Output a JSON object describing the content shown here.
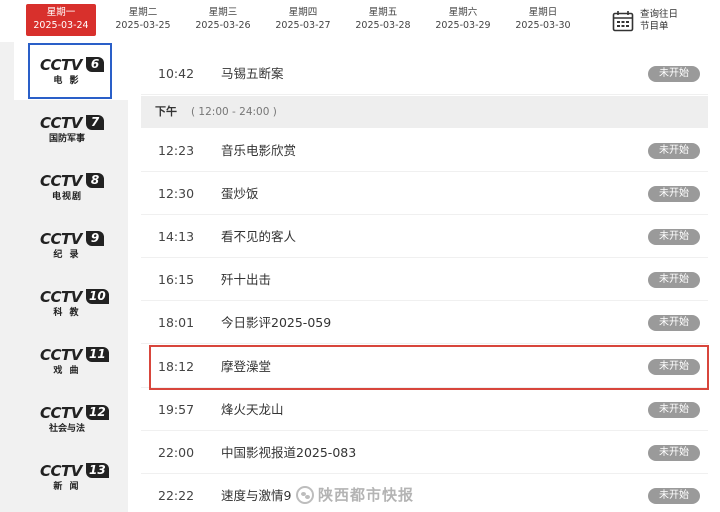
{
  "dates": [
    {
      "weekday": "星期一",
      "date": "2025-03-24",
      "active": true
    },
    {
      "weekday": "星期二",
      "date": "2025-03-25"
    },
    {
      "weekday": "星期三",
      "date": "2025-03-26"
    },
    {
      "weekday": "星期四",
      "date": "2025-03-27"
    },
    {
      "weekday": "星期五",
      "date": "2025-03-28"
    },
    {
      "weekday": "星期六",
      "date": "2025-03-29"
    },
    {
      "weekday": "星期日",
      "date": "2025-03-30"
    }
  ],
  "history": {
    "line1": "查询往日",
    "line2": "节目单",
    "icon": "calendar-icon"
  },
  "channels": [
    {
      "word": "CCTV",
      "num": "6",
      "sub": "电 影",
      "selected": true
    },
    {
      "word": "CCTV",
      "num": "7",
      "sub": "国防军事"
    },
    {
      "word": "CCTV",
      "num": "8",
      "sub": "电视剧"
    },
    {
      "word": "CCTV",
      "num": "9",
      "sub": "纪 录"
    },
    {
      "word": "CCTV",
      "num": "10",
      "sub": "科 教"
    },
    {
      "word": "CCTV",
      "num": "11",
      "sub": "戏 曲"
    },
    {
      "word": "CCTV",
      "num": "12",
      "sub": "社会与法"
    },
    {
      "word": "CCTV",
      "num": "13",
      "sub": "新 闻"
    }
  ],
  "section": {
    "label": "下午",
    "range": "( 12:00 - 24:00 )"
  },
  "programs": [
    {
      "time": "10:42",
      "title": "马锡五断案",
      "status": "未开始"
    },
    {
      "time": "12:23",
      "title": "音乐电影欣赏",
      "status": "未开始"
    },
    {
      "time": "12:30",
      "title": "蛋炒饭",
      "status": "未开始"
    },
    {
      "time": "14:13",
      "title": "看不见的客人",
      "status": "未开始"
    },
    {
      "time": "16:15",
      "title": "歼十出击",
      "status": "未开始"
    },
    {
      "time": "18:01",
      "title": "今日影评2025-059",
      "status": "未开始"
    },
    {
      "time": "18:12",
      "title": "摩登澡堂",
      "status": "未开始",
      "highlighted": true
    },
    {
      "time": "19:57",
      "title": "烽火天龙山",
      "status": "未开始"
    },
    {
      "time": "22:00",
      "title": "中国影视报道2025-083",
      "status": "未开始"
    },
    {
      "time": "22:22",
      "title": "速度与激情9",
      "status": "未开始"
    }
  ],
  "watermark": {
    "text": "陕西都市快报"
  },
  "colors": {
    "active_date": "#d8302c",
    "selected_channel_border": "#2a5fc8",
    "highlight_border": "#d8463c",
    "badge": "#9a9a9a"
  }
}
